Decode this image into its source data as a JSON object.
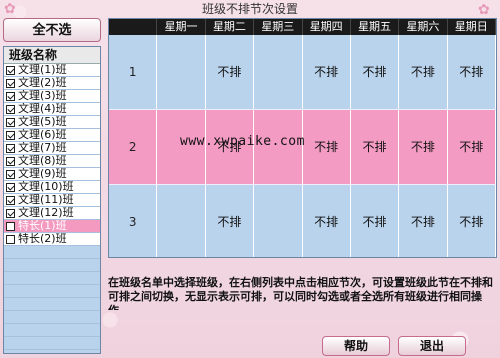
{
  "window": {
    "title": "班级不排节次设置"
  },
  "left_panel": {
    "select_all_label": "全不选",
    "list_header": "班级名称",
    "classes": [
      {
        "label": "文理(1)班",
        "checked": true,
        "selected": false
      },
      {
        "label": "文理(2)班",
        "checked": true,
        "selected": false
      },
      {
        "label": "文理(3)班",
        "checked": true,
        "selected": false
      },
      {
        "label": "文理(4)班",
        "checked": true,
        "selected": false
      },
      {
        "label": "文理(5)班",
        "checked": true,
        "selected": false
      },
      {
        "label": "文理(6)班",
        "checked": true,
        "selected": false
      },
      {
        "label": "文理(7)班",
        "checked": true,
        "selected": false
      },
      {
        "label": "文理(8)班",
        "checked": true,
        "selected": false
      },
      {
        "label": "文理(9)班",
        "checked": true,
        "selected": false
      },
      {
        "label": "文理(10)班",
        "checked": true,
        "selected": false
      },
      {
        "label": "文理(11)班",
        "checked": true,
        "selected": false
      },
      {
        "label": "文理(12)班",
        "checked": true,
        "selected": false
      },
      {
        "label": "特长(1)班",
        "checked": false,
        "selected": true
      },
      {
        "label": "特长(2)班",
        "checked": false,
        "selected": false
      }
    ]
  },
  "grid": {
    "days": [
      "星期一",
      "星期二",
      "星期三",
      "星期四",
      "星期五",
      "星期六",
      "星期日"
    ],
    "rows": [
      {
        "period": "1",
        "cells": [
          "",
          "不排",
          "",
          "不排",
          "不排",
          "不排",
          "不排"
        ],
        "highlight": false
      },
      {
        "period": "2",
        "cells": [
          "",
          "不排",
          "",
          "不排",
          "不排",
          "不排",
          "不排"
        ],
        "highlight": true
      },
      {
        "period": "3",
        "cells": [
          "",
          "不排",
          "",
          "不排",
          "不排",
          "不排",
          "不排"
        ],
        "highlight": false
      }
    ]
  },
  "watermark": "www.xwpaike.com",
  "instruction": "在班级名单中选择班级，在右侧列表中点击相应节次，可设置班级此节在不排和可排之间切换，无显示表示可排，可以同时勾选或者全选所有班级进行相同操作。",
  "buttons": {
    "help": "帮助",
    "exit": "退出"
  },
  "colors": {
    "highlight_row": "#f39bc3",
    "list_bg": "#bad3ec",
    "header_bg": "#1a1a1a",
    "selected_item": "#f49ac0"
  }
}
